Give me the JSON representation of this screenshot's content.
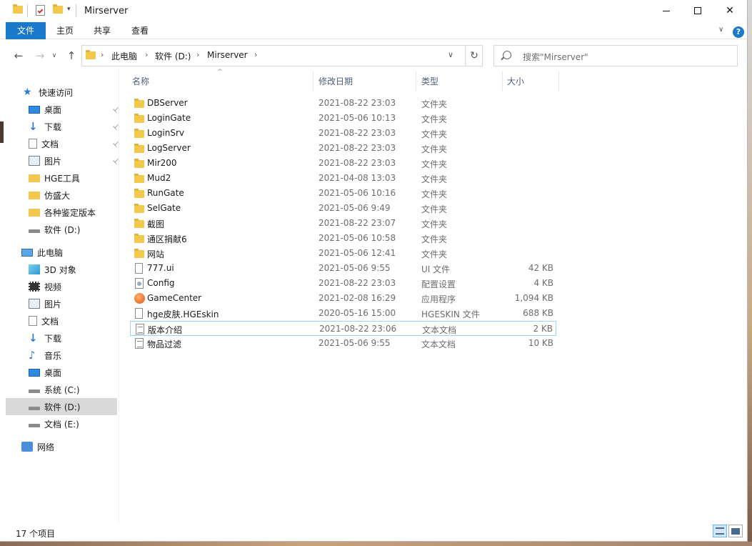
{
  "window": {
    "title": "Mirserver"
  },
  "ribbon": {
    "tabs": [
      "文件",
      "主页",
      "共享",
      "查看"
    ],
    "help": "?"
  },
  "address": {
    "crumbs": [
      "此电脑",
      "软件 (D:)",
      "Mirserver"
    ],
    "search_placeholder": "搜索\"Mirserver\""
  },
  "nav": {
    "quick_access": "快速访问",
    "quick_items": [
      {
        "label": "桌面",
        "icon": "desktop-icon",
        "pinned": true
      },
      {
        "label": "下载",
        "icon": "download-icon",
        "pinned": true
      },
      {
        "label": "文档",
        "icon": "document-icon",
        "pinned": true
      },
      {
        "label": "图片",
        "icon": "picture-icon",
        "pinned": true
      },
      {
        "label": "HGE工具",
        "icon": "folder-icon",
        "pinned": false
      },
      {
        "label": "仿盛大",
        "icon": "folder-icon",
        "pinned": false
      },
      {
        "label": "各种鉴定版本",
        "icon": "folder-icon",
        "pinned": false
      },
      {
        "label": "软件 (D:)",
        "icon": "drive-icon",
        "pinned": false
      }
    ],
    "this_pc": "此电脑",
    "pc_items": [
      {
        "label": "3D 对象",
        "icon": "3d-objects-icon"
      },
      {
        "label": "视频",
        "icon": "video-icon"
      },
      {
        "label": "图片",
        "icon": "picture-icon"
      },
      {
        "label": "文档",
        "icon": "document-icon"
      },
      {
        "label": "下载",
        "icon": "download-icon"
      },
      {
        "label": "音乐",
        "icon": "music-icon"
      },
      {
        "label": "桌面",
        "icon": "desktop-icon"
      },
      {
        "label": "系统 (C:)",
        "icon": "system-drive-icon"
      },
      {
        "label": "软件 (D:)",
        "icon": "drive-icon",
        "selected": true
      },
      {
        "label": "文档 (E:)",
        "icon": "drive-icon"
      }
    ],
    "network": "网络"
  },
  "columns": {
    "name": "名称",
    "date": "修改日期",
    "type": "类型",
    "size": "大小"
  },
  "files": [
    {
      "name": "DBServer",
      "date": "2021-08-22 23:03",
      "type": "文件夹",
      "size": "",
      "kind": "folder"
    },
    {
      "name": "LoginGate",
      "date": "2021-05-06 10:13",
      "type": "文件夹",
      "size": "",
      "kind": "folder"
    },
    {
      "name": "LoginSrv",
      "date": "2021-08-22 23:03",
      "type": "文件夹",
      "size": "",
      "kind": "folder"
    },
    {
      "name": "LogServer",
      "date": "2021-08-22 23:03",
      "type": "文件夹",
      "size": "",
      "kind": "folder"
    },
    {
      "name": "Mir200",
      "date": "2021-08-22 23:03",
      "type": "文件夹",
      "size": "",
      "kind": "folder"
    },
    {
      "name": "Mud2",
      "date": "2021-04-08 13:03",
      "type": "文件夹",
      "size": "",
      "kind": "folder"
    },
    {
      "name": "RunGate",
      "date": "2021-05-06 10:16",
      "type": "文件夹",
      "size": "",
      "kind": "folder"
    },
    {
      "name": "SelGate",
      "date": "2021-05-06 9:49",
      "type": "文件夹",
      "size": "",
      "kind": "folder"
    },
    {
      "name": "截图",
      "date": "2021-08-22 23:07",
      "type": "文件夹",
      "size": "",
      "kind": "folder"
    },
    {
      "name": "通区捐献6",
      "date": "2021-05-06 10:58",
      "type": "文件夹",
      "size": "",
      "kind": "folder"
    },
    {
      "name": "网站",
      "date": "2021-05-06 12:41",
      "type": "文件夹",
      "size": "",
      "kind": "folder"
    },
    {
      "name": "777.ui",
      "date": "2021-05-06 9:55",
      "type": "UI 文件",
      "size": "42 KB",
      "kind": "file"
    },
    {
      "name": "Config",
      "date": "2021-08-22 23:03",
      "type": "配置设置",
      "size": "4 KB",
      "kind": "cfg"
    },
    {
      "name": "GameCenter",
      "date": "2021-02-08 16:29",
      "type": "应用程序",
      "size": "1,094 KB",
      "kind": "exe"
    },
    {
      "name": "hge皮肤.HGEskin",
      "date": "2020-05-16 15:00",
      "type": "HGESKIN 文件",
      "size": "688 KB",
      "kind": "file"
    },
    {
      "name": "版本介绍",
      "date": "2021-08-22 23:06",
      "type": "文本文档",
      "size": "2 KB",
      "kind": "txt",
      "selected": true
    },
    {
      "name": "物品过滤",
      "date": "2021-05-06 9:55",
      "type": "文本文档",
      "size": "10 KB",
      "kind": "txt"
    }
  ],
  "status": {
    "count": "17 个项目"
  }
}
